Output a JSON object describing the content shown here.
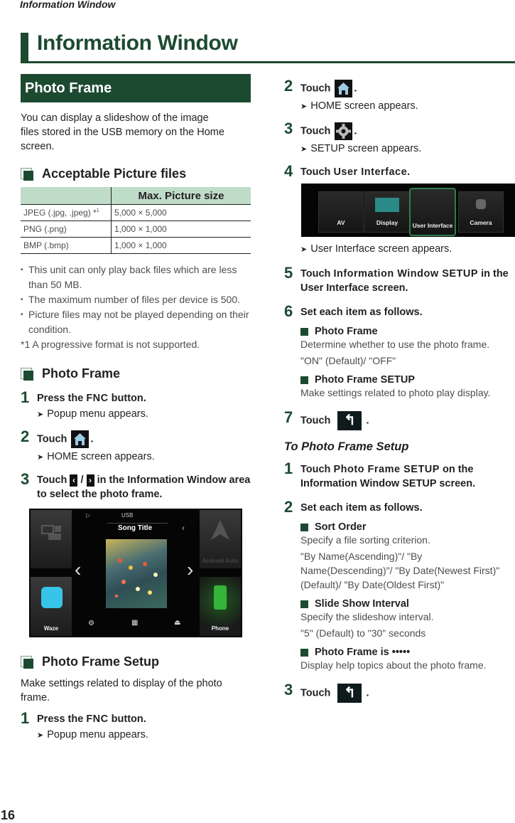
{
  "running_head": "Information Window",
  "page_title": "Information Window",
  "page_number": "16",
  "photo_frame": {
    "section_title": "Photo Frame",
    "intro": "You can display a slideshow of the image files stored in the USB memory on the Home screen.",
    "acceptable": {
      "heading": "Acceptable Picture files",
      "table": {
        "headers": [
          "",
          "Max. Picture size"
        ],
        "rows": [
          {
            "format": "JPEG (.jpg, .jpeg) *",
            "footnote_mark": "1",
            "size": "5,000 × 5,000"
          },
          {
            "format": "PNG (.png)",
            "footnote_mark": "",
            "size": "1,000 × 1,000"
          },
          {
            "format": "BMP (.bmp)",
            "footnote_mark": "",
            "size": "1,000 × 1,000"
          }
        ]
      },
      "bullets": [
        "This unit can only play back files which are less than 50 MB.",
        "The maximum number of files per device is 500.",
        "Picture files may not be played depending on their condition."
      ],
      "footnote": "*1 A progressive format is not supported."
    },
    "usage": {
      "heading": "Photo Frame",
      "steps": [
        {
          "num": "1",
          "pre": "Press the ",
          "key": "FNC",
          "post": " button.",
          "result": "Popup menu appears."
        },
        {
          "num": "2",
          "pre": "Touch ",
          "icon": "home-icon",
          "post": ".",
          "result": "HOME screen appears."
        },
        {
          "num": "3",
          "pre": "Touch ",
          "mid": " / ",
          "post": " in the Information Window area to select the photo frame.",
          "icon_left": "‹",
          "icon_right": "›"
        }
      ],
      "home_screen": {
        "source": "USB",
        "song_title": "Song Title",
        "left_bottom_app": "Waze",
        "right_top_app": "Android Auto",
        "right_bottom_app": "Phone"
      }
    },
    "setup": {
      "heading": "Photo Frame Setup",
      "intro": "Make settings related to display of the photo frame.",
      "steps": [
        {
          "num": "1",
          "pre": "Press the ",
          "key": "FNC",
          "post": " button.",
          "result": "Popup menu appears."
        },
        {
          "num": "2",
          "pre": "Touch ",
          "icon": "home-icon",
          "post": ".",
          "result": "HOME screen appears."
        },
        {
          "num": "3",
          "pre": "Touch ",
          "icon": "gear-icon",
          "post": ".",
          "result": "SETUP screen appears."
        },
        {
          "num": "4",
          "pre": "Touch ",
          "key": "User Interface",
          "post": ".",
          "result": "User Interface screen appears."
        },
        {
          "num": "5",
          "pre": "Touch ",
          "key": "Information Window SETUP",
          "post": " in the User Interface screen."
        },
        {
          "num": "6",
          "text": "Set each item as follows."
        },
        {
          "num": "7",
          "pre": "Touch ",
          "icon": "back-icon",
          "post": "."
        }
      ],
      "setup_menu": [
        "AV",
        "Display",
        "User Interface",
        "Camera"
      ],
      "items": [
        {
          "title": "Photo Frame",
          "desc": "Determine whether to use the photo frame.",
          "options": "\"ON\" (Default)/ \"OFF\""
        },
        {
          "title": "Photo Frame SETUP",
          "desc": "Make settings related to photo play display.",
          "options": ""
        }
      ]
    },
    "to_setup": {
      "heading": "To Photo Frame Setup",
      "steps": [
        {
          "num": "1",
          "pre": "Touch ",
          "key": "Photo Frame SETUP",
          "post": " on the Information Window SETUP screen."
        },
        {
          "num": "2",
          "text": "Set each item as follows."
        },
        {
          "num": "3",
          "pre": "Touch ",
          "icon": "back-icon",
          "post": "."
        }
      ],
      "items": [
        {
          "title": "Sort Order",
          "desc": "Specify a file sorting criterion.",
          "options": "\"By Name(Ascending)\"/ \"By Name(Descending)\"/ \"By Date(Newest First)\" (Default)/ \"By Date(Oldest First)\""
        },
        {
          "title": "Slide Show Interval",
          "desc": "Specify the slideshow interval.",
          "options": "\"5\" (Default) to \"30\" seconds"
        },
        {
          "title": "Photo Frame is •••••",
          "desc": "Display help topics about the photo frame.",
          "options": ""
        }
      ]
    }
  },
  "colors": {
    "brand_green": "#1c4a30",
    "table_header": "#bfdcc8"
  }
}
